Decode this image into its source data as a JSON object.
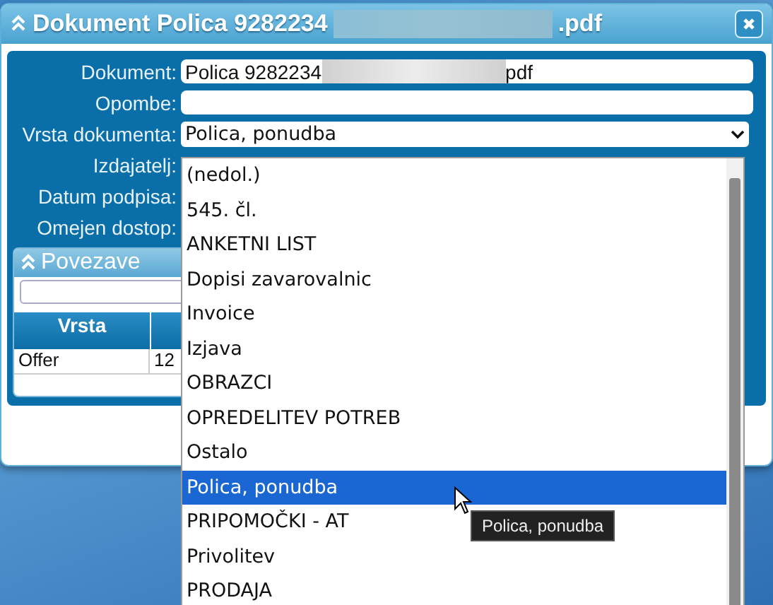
{
  "window": {
    "title_start": "Dokument Polica 9282234",
    "title_end": ".pdf"
  },
  "fields": [
    {
      "label": "Dokument:",
      "kind": "text",
      "value_start": "Polica 9282234",
      "value_end": "pdf"
    },
    {
      "label": "Opombe:",
      "kind": "text"
    },
    {
      "label": "Vrsta dokumenta:",
      "kind": "select",
      "value": "Polica, ponudba"
    },
    {
      "label": "Izdajatelj:",
      "kind": "covered"
    },
    {
      "label": "Datum podpisa:",
      "kind": "covered"
    },
    {
      "label": "Omejen dostop:",
      "kind": "covered"
    }
  ],
  "links_panel": {
    "title": "Povezave",
    "columns": [
      "Vrsta"
    ],
    "rows": [
      [
        "Offer",
        "12"
      ]
    ]
  },
  "dropdown": {
    "options": [
      {
        "label": "(nedol.)",
        "selected": false
      },
      {
        "label": "545. čl.",
        "selected": false
      },
      {
        "label": "ANKETNI LIST",
        "selected": false
      },
      {
        "label": "Dopisi zavarovalnic",
        "selected": false
      },
      {
        "label": "Invoice",
        "selected": false
      },
      {
        "label": "Izjava",
        "selected": false
      },
      {
        "label": "OBRAZCI",
        "selected": false
      },
      {
        "label": "OPREDELITEV POTREB",
        "selected": false
      },
      {
        "label": "Ostalo",
        "selected": false
      },
      {
        "label": "Polica, ponudba",
        "selected": true
      },
      {
        "label": "PRIPOMOČKI - AT",
        "selected": false
      },
      {
        "label": "Privolitev",
        "selected": false
      },
      {
        "label": "PRODAJA",
        "selected": false
      }
    ],
    "tooltip": "Polica, ponudba"
  }
}
